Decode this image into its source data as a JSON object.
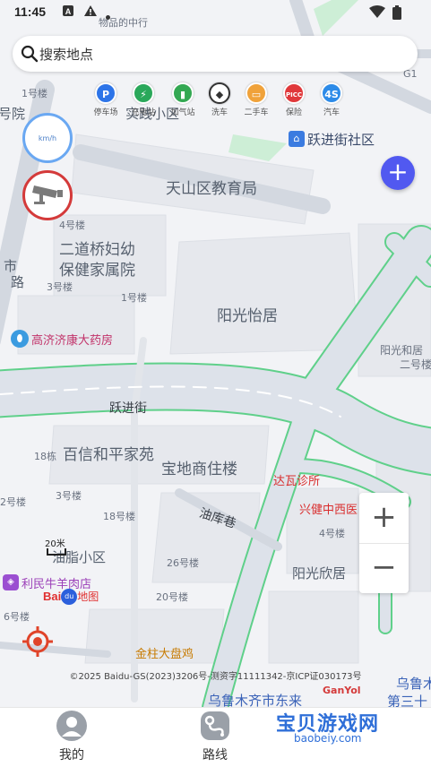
{
  "status_bar": {
    "time": "11:45",
    "icons": [
      "font-icon",
      "warning-icon",
      "dot-icon",
      "wifi-icon",
      "battery-icon"
    ]
  },
  "search": {
    "placeholder": "搜索地点"
  },
  "poi_shortcuts": [
    {
      "label": "停车场",
      "glyph": "P",
      "color": "#2d74e8"
    },
    {
      "label": "充电站",
      "glyph": "⚡",
      "color": "#2aa85a"
    },
    {
      "label": "加气站",
      "glyph": "⛽",
      "color": "#33a852"
    },
    {
      "label": "洗车",
      "glyph": "◆",
      "color": "#333333"
    },
    {
      "label": "二手车",
      "glyph": "▭",
      "color": "#f0a23a"
    },
    {
      "label": "保险",
      "glyph": "PICC",
      "color": "#e0383b"
    },
    {
      "label": "汽车",
      "glyph": "4S",
      "color": "#2d8be8"
    }
  ],
  "speed_widget": {
    "unit": "km/h"
  },
  "map_labels": {
    "top_building": "实践小区",
    "top_bank_fragment": "物品的中行",
    "top_building_left": "1号楼",
    "top_left_fragment": "号院",
    "g1_road": "G1",
    "community": "跃进街社区",
    "education_bureau": "天山区教育局",
    "building_4": "4号楼",
    "hospital_line1": "二道桥妇幼",
    "hospital_line2": "保健家属院",
    "building_3": "3号楼",
    "building_1": "1号楼",
    "city_road_left": "市",
    "city_road_left2": "路",
    "yangguang_yiju": "阳光怡居",
    "pharmacy": "高济济康大药房",
    "yangguang_hexi": "阳光和居",
    "building_2_right": "二号楼",
    "yuejin_street": "跃进街",
    "baixin": "百信和平家苑",
    "building_18_left": "18栋",
    "baodi": "宝地商住楼",
    "dawa_clinic": "达瓦诊所",
    "building_2": "2号楼",
    "building_3b": "3号楼",
    "building_18": "18号楼",
    "youku_lane": "油库巷",
    "xingjian": "兴健中西医",
    "building_4b": "4号楼",
    "youzhi": "油脂小区",
    "building_26": "26号楼",
    "yangguang_xinju": "阳光欣居",
    "limin": "利民牛羊肉店",
    "building_6": "6号楼",
    "building_20": "20号楼",
    "jinzhu": "金柱大盘鸡",
    "urumqi_right": "乌鲁木",
    "urumqi_bottom": "乌鲁木齐市东来",
    "third_right": "第三十"
  },
  "scale": {
    "text": "20米"
  },
  "logo": {
    "text": "Bai",
    "paw": "du",
    "suffix": "地图"
  },
  "copyright": "©2025 Baidu-GS(2023)3206号-测资字11111342-京ICP证030173号",
  "bottom_nav": [
    {
      "label": "我的"
    },
    {
      "label": "路线"
    }
  ],
  "watermark": {
    "main": "宝贝游戏网",
    "sub": "baobeiy.com",
    "badge": "GanYol"
  },
  "colors": {
    "accent": "#5159f0",
    "road_outline": "#5fd08a",
    "road_fill": "#dde2ea",
    "building": "#e7e9ee",
    "green_area": "#cdeed6",
    "speed_ring": "#6aa8f2",
    "camera_ring": "#d43a3a"
  }
}
